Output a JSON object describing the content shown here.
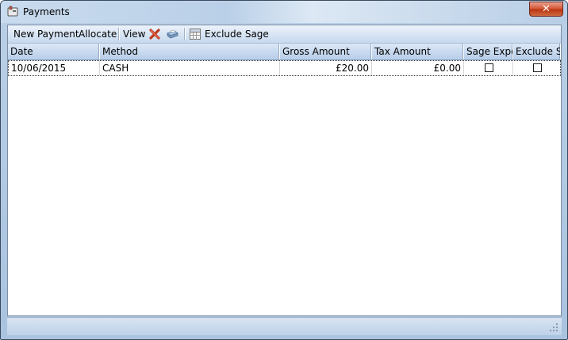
{
  "window": {
    "title": "Payments",
    "close_label": "✕"
  },
  "toolbar": {
    "new_payment": "New Payment",
    "allocate": "Allocate",
    "view": "View",
    "delete_icon": "red-x-icon",
    "print_icon": "printer-icon",
    "exclude_icon": "grid-icon",
    "exclude_sage": "Exclude Sage"
  },
  "grid": {
    "columns": [
      "Date",
      "Method",
      "Gross Amount",
      "Tax Amount",
      "Sage Expo",
      "Exclude S"
    ],
    "rows": [
      {
        "date": "10/06/2015",
        "method": "CASH",
        "gross": "£20.00",
        "tax": "£0.00",
        "sage_export": false,
        "exclude_sage": false
      }
    ]
  }
}
